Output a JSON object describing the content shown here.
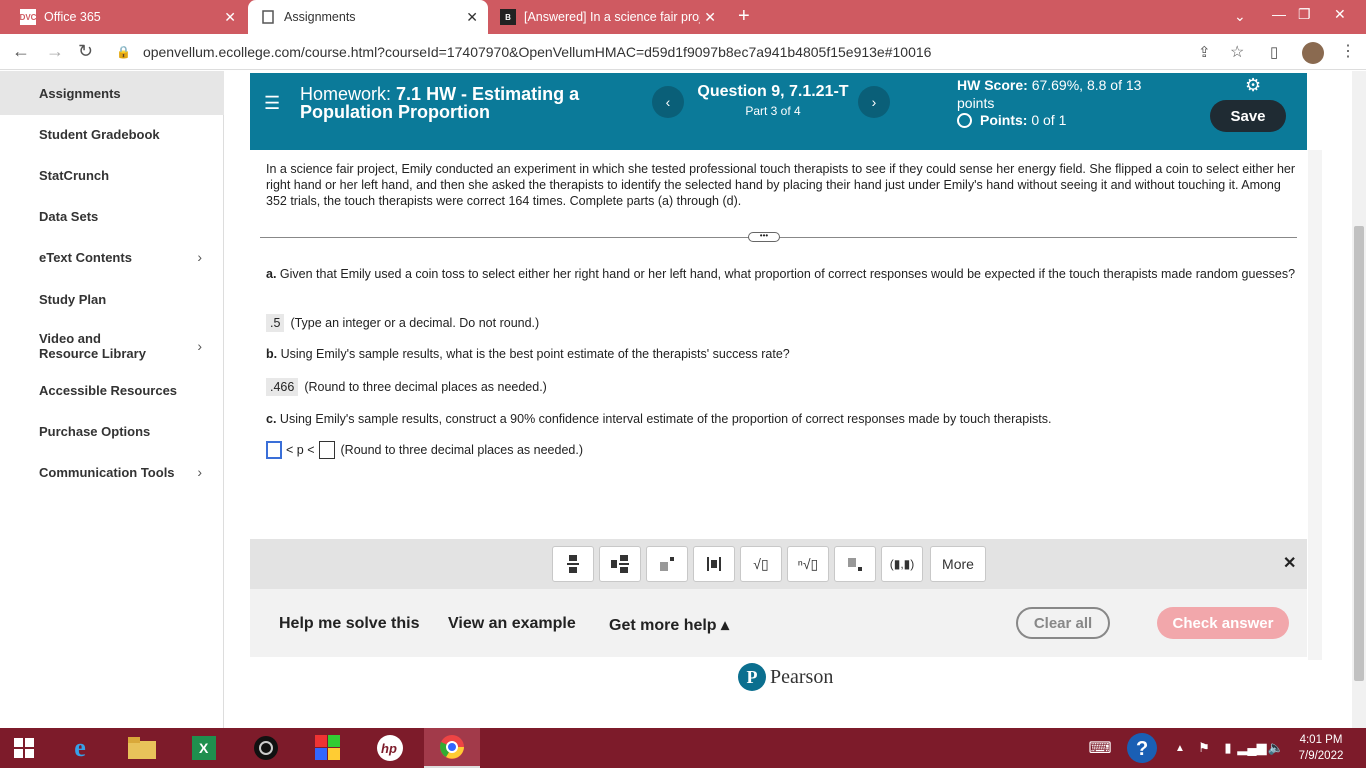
{
  "browser": {
    "tabs": [
      {
        "label": "Office 365",
        "favicon": "DVC"
      },
      {
        "label": "Assignments",
        "favicon": "doc"
      },
      {
        "label": "[Answered] In a science fair proje",
        "favicon": "B"
      }
    ],
    "url": "openvellum.ecollege.com/course.html?courseId=17407970&OpenVellumHMAC=d59d1f9097b8ec7a941b4805f15e913e#10016"
  },
  "sidebar": {
    "items": [
      {
        "label": "Assignments",
        "active": true
      },
      {
        "label": "Student Gradebook"
      },
      {
        "label": "StatCrunch"
      },
      {
        "label": "Data Sets"
      },
      {
        "label": "eText Contents",
        "chevron": true
      },
      {
        "label": "Study Plan"
      },
      {
        "label": "Video and Resource Library",
        "chevron": true
      },
      {
        "label": "Accessible Resources"
      },
      {
        "label": "Purchase Options"
      },
      {
        "label": "Communication Tools",
        "chevron": true
      }
    ]
  },
  "header": {
    "hw_prefix": "Homework:",
    "hw_title_1": "7.1 HW - Estimating a",
    "hw_title_2": "Population Proportion",
    "question": "Question 9, 7.1.21-T",
    "part": "Part 3 of 4",
    "score_label": "HW Score:",
    "score_value": "67.69%, 8.8 of 13",
    "score_unit": "points",
    "points_label": "Points:",
    "points_value": "0 of 1",
    "save": "Save"
  },
  "problem": {
    "intro": "In a science fair project, Emily conducted an experiment in which she tested professional touch therapists to see if they could sense her energy field. She flipped a coin to select either her right hand or her left hand, and then she asked the therapists to identify the selected hand by placing their hand just under Emily's hand without seeing it and without touching it. Among 352 trials, the touch therapists were correct 164 times. Complete parts (a) through (d).",
    "a_label": "a.",
    "a_text": "Given that Emily used a coin toss to select either her right hand or her left hand, what proportion of correct responses would be expected if the touch therapists made random guesses?",
    "a_answer": ".5",
    "a_hint": "(Type an integer or a decimal. Do not round.)",
    "b_label": "b.",
    "b_text": "Using Emily's sample results, what is the best point estimate of the therapists' success rate?",
    "b_answer": ".466",
    "b_hint": "(Round to three decimal places as needed.)",
    "c_label": "c.",
    "c_text": "Using Emily's sample results, construct a 90% confidence interval estimate of the proportion of correct responses made by touch therapists.",
    "c_middle": "< p <",
    "c_hint": "(Round to three decimal places as needed.)"
  },
  "mathbar": {
    "more": "More",
    "buttons": [
      "fraction-icon",
      "mixed-number-icon",
      "exponent-icon",
      "absolute-value-icon",
      "sqrt-icon",
      "nth-root-icon",
      "subscript-icon",
      "ordered-pair-icon"
    ]
  },
  "help": {
    "solve": "Help me solve this",
    "example": "View an example",
    "more_help": "Get more help ▴",
    "clear": "Clear all",
    "check": "Check answer"
  },
  "footer": {
    "brand": "Pearson"
  },
  "taskbar": {
    "time": "4:01 PM",
    "date": "7/9/2022"
  }
}
